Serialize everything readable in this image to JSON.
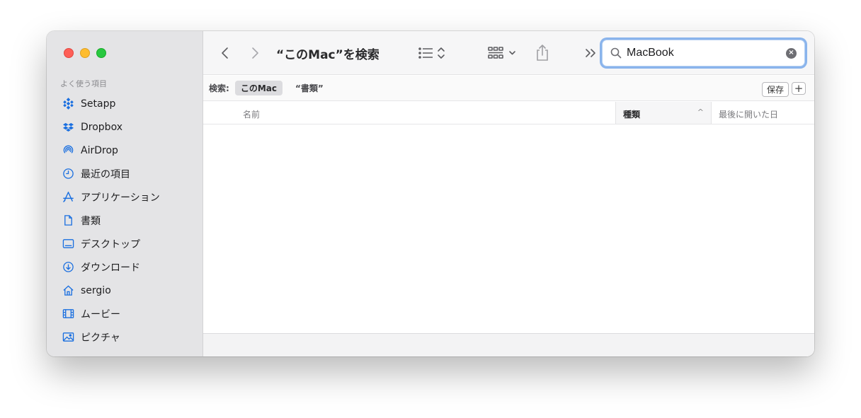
{
  "window": {
    "title": "“このMac”を検索"
  },
  "sidebar": {
    "section_title": "よく使う項目",
    "items": [
      {
        "label": "Setapp",
        "icon": "setapp-icon"
      },
      {
        "label": "Dropbox",
        "icon": "dropbox-icon"
      },
      {
        "label": "AirDrop",
        "icon": "airdrop-icon"
      },
      {
        "label": "最近の項目",
        "icon": "clock-icon"
      },
      {
        "label": "アプリケーション",
        "icon": "applications-icon"
      },
      {
        "label": "書類",
        "icon": "document-icon"
      },
      {
        "label": "デスクトップ",
        "icon": "desktop-icon"
      },
      {
        "label": "ダウンロード",
        "icon": "download-icon"
      },
      {
        "label": "sergio",
        "icon": "home-icon"
      },
      {
        "label": "ムービー",
        "icon": "film-icon"
      },
      {
        "label": "ピクチャ",
        "icon": "photo-icon"
      }
    ]
  },
  "toolbar": {
    "search_value": "MacBook"
  },
  "scope": {
    "label": "検索:",
    "active": "このMac",
    "other": "“書類”",
    "save_label": "保存",
    "add_label": "+"
  },
  "columns": {
    "name": "名前",
    "kind": "種類",
    "kind_sort": "^",
    "date": "最後に開いた日"
  },
  "colors": {
    "accent": "#1a6fe0",
    "close": "#fe5f57",
    "minimize": "#febc2e",
    "zoom": "#28c840"
  }
}
